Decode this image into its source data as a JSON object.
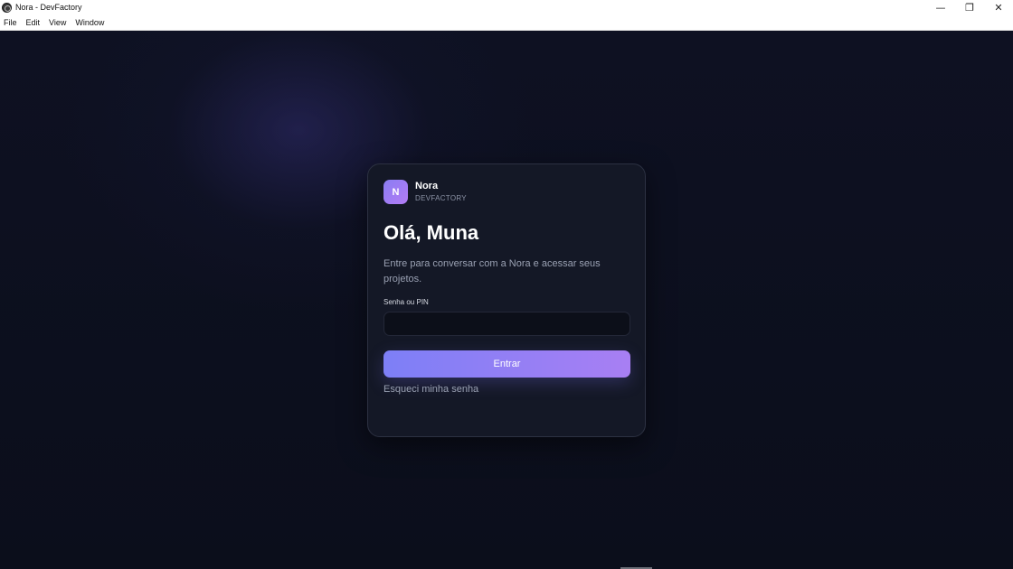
{
  "window": {
    "title": "Nora - DevFactory",
    "minimize_glyph": "—",
    "restore_glyph": "❐",
    "close_glyph": "✕"
  },
  "menu": {
    "items": [
      "File",
      "Edit",
      "View",
      "Window"
    ]
  },
  "card": {
    "avatar_letter": "N",
    "brand_name": "Nora",
    "brand_sub": "DEVFACTORY",
    "greeting": "Olá, Muna",
    "subtitle": "Entre para conversar com a Nora e acessar seus projetos.",
    "field_label": "Senha ou PIN",
    "input_value": "",
    "submit_label": "Entrar",
    "forgot_label": "Esqueci minha senha"
  },
  "colors": {
    "background": "#0c0f1c",
    "card": "#141826",
    "accent_start": "#7d7ff6",
    "accent_end": "#a87ff3"
  },
  "icons": {
    "app": "app-logo-icon",
    "minimize": "minimize-icon",
    "restore": "restore-icon",
    "close": "close-icon"
  }
}
